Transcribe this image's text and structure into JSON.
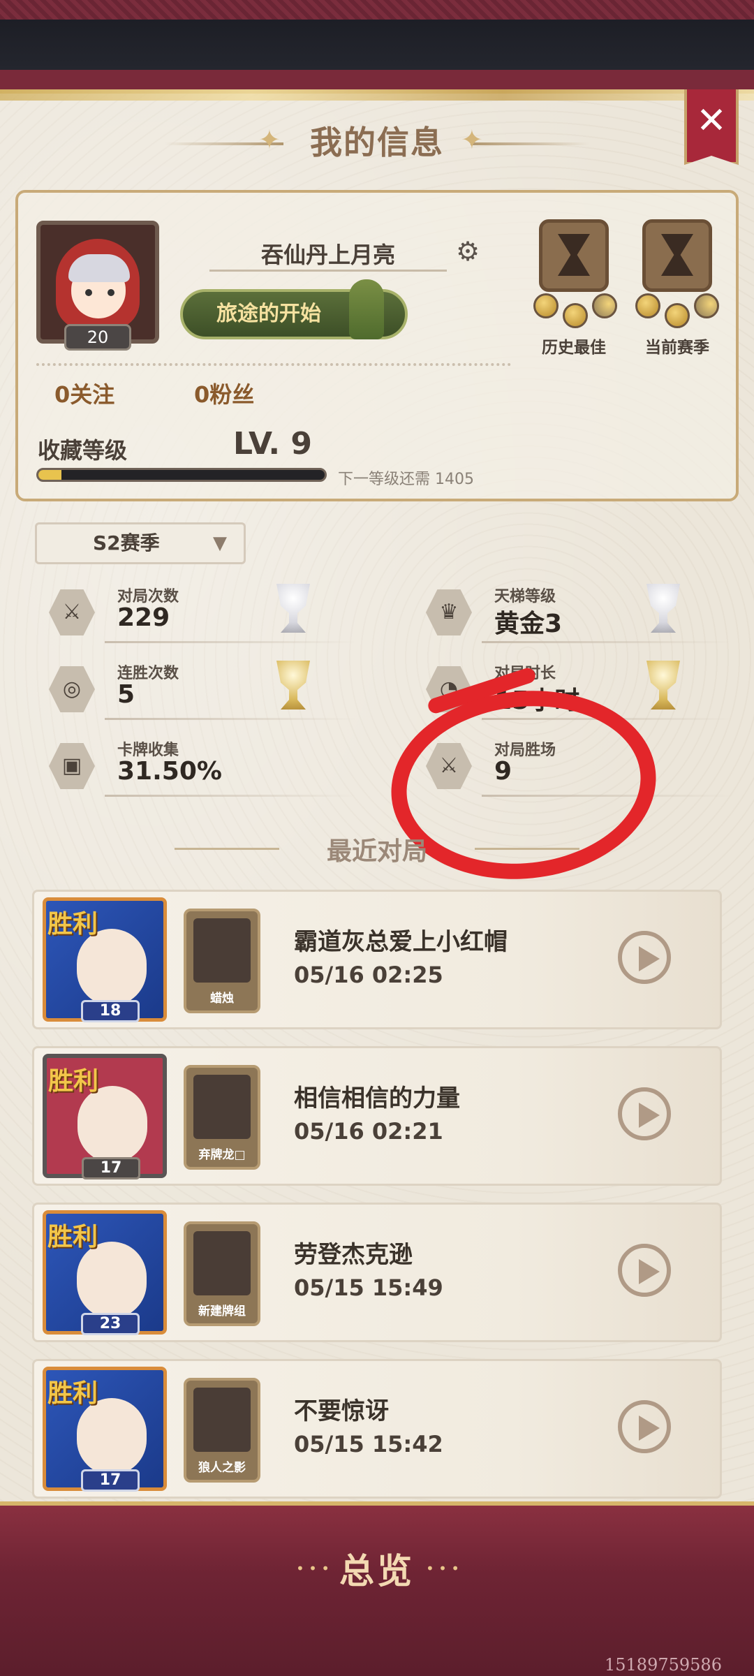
{
  "header": {
    "title": "我的信息",
    "close_label": "✕"
  },
  "profile": {
    "username": "吞仙丹上月亮",
    "level": "20",
    "title_badge": "旅途的开始",
    "follow": "0关注",
    "fans": "0粉丝",
    "collection_label": "收藏等级",
    "collection_level": "LV. 9",
    "collection_progress": 0.08,
    "next_level_text": "下一等级还需 1405",
    "trophies": [
      {
        "label": "历史最佳"
      },
      {
        "label": "当前赛季"
      }
    ]
  },
  "season": {
    "selected": "S2赛季"
  },
  "stats": [
    {
      "label": "对局次数",
      "value": "229",
      "icon": "swords-icon"
    },
    {
      "label": "天梯等级",
      "value": "黄金3",
      "icon": "crown-icon"
    },
    {
      "label": "连胜次数",
      "value": "5",
      "icon": "streak-icon"
    },
    {
      "label": "对局时长",
      "value": "15小时",
      "icon": "clock-icon"
    },
    {
      "label": "卡牌收集",
      "value": "31.50%",
      "icon": "card-icon"
    },
    {
      "label": "对局胜场",
      "value": "9",
      "icon": "swords-icon"
    }
  ],
  "recent": {
    "title": "最近对局",
    "matches": [
      {
        "result": "胜利",
        "level": "18",
        "deck": "蜡烛",
        "opponent": "霸道灰总爱上小红帽",
        "time": "05/16 02:25"
      },
      {
        "result": "胜利",
        "level": "17",
        "deck": "弃牌龙□",
        "opponent": "相信相信的力量",
        "time": "05/16 02:21"
      },
      {
        "result": "胜利",
        "level": "23",
        "deck": "新建牌组",
        "opponent": "劳登杰克逊",
        "time": "05/15 15:49"
      },
      {
        "result": "胜利",
        "level": "17",
        "deck": "狼人之影",
        "opponent": "不要惊讶",
        "time": "05/15 15:42"
      }
    ]
  },
  "footer": {
    "tab": "总览",
    "watermark": "15189759586"
  },
  "colors": {
    "accent": "#a8283a",
    "annotation": "#e3262a",
    "gold": "#d6b56a"
  }
}
